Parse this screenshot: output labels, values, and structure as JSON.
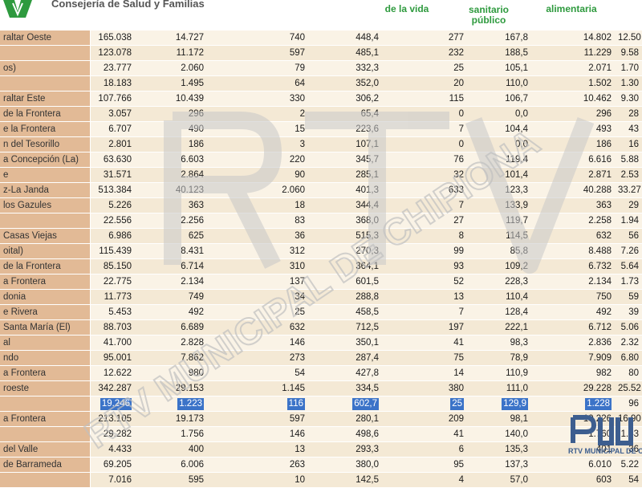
{
  "header": {
    "org_name": "Consejería de Salud y Familias",
    "col_heads": [
      "de la vida",
      "sanitario",
      "público",
      "alimentaria"
    ]
  },
  "watermark": {
    "text": "RTV MUNICIPAL DE CHIPIONA",
    "logo_text": "RTV MUNICIPAL DE CH"
  },
  "colors": {
    "name_cell": "#e2ba96",
    "row_odd": "#faf3e6",
    "row_even": "#f4e9d5",
    "header_text": "#2e9a3e",
    "selection": "#3b73c8"
  },
  "rows": [
    {
      "name": "raltar Oeste",
      "c1": "165.038",
      "c2": "14.727",
      "c3": "740",
      "c4": "448,4",
      "c5": "277",
      "c6": "167,8",
      "c7": "14.802",
      "c8": "12.50"
    },
    {
      "name": "",
      "c1": "123.078",
      "c2": "11.172",
      "c3": "597",
      "c4": "485,1",
      "c5": "232",
      "c6": "188,5",
      "c7": "11.229",
      "c8": "9.58"
    },
    {
      "name": "os)",
      "c1": "23.777",
      "c2": "2.060",
      "c3": "79",
      "c4": "332,3",
      "c5": "25",
      "c6": "105,1",
      "c7": "2.071",
      "c8": "1.70"
    },
    {
      "name": "",
      "c1": "18.183",
      "c2": "1.495",
      "c3": "64",
      "c4": "352,0",
      "c5": "20",
      "c6": "110,0",
      "c7": "1.502",
      "c8": "1.30"
    },
    {
      "name": "raltar Este",
      "c1": "107.766",
      "c2": "10.439",
      "c3": "330",
      "c4": "306,2",
      "c5": "115",
      "c6": "106,7",
      "c7": "10.462",
      "c8": "9.30"
    },
    {
      "name": "de la Frontera",
      "c1": "3.057",
      "c2": "296",
      "c3": "2",
      "c4": "65,4",
      "c5": "0",
      "c6": "0,0",
      "c7": "296",
      "c8": "28"
    },
    {
      "name": "e la Frontera",
      "c1": "6.707",
      "c2": "490",
      "c3": "15",
      "c4": "223,6",
      "c5": "7",
      "c6": "104,4",
      "c7": "493",
      "c8": "43"
    },
    {
      "name": "n del Tesorillo",
      "c1": "2.801",
      "c2": "186",
      "c3": "3",
      "c4": "107,1",
      "c5": "0",
      "c6": "0,0",
      "c7": "186",
      "c8": "16"
    },
    {
      "name": "a Concepción (La)",
      "c1": "63.630",
      "c2": "6.603",
      "c3": "220",
      "c4": "345,7",
      "c5": "76",
      "c6": "119,4",
      "c7": "6.616",
      "c8": "5.88"
    },
    {
      "name": "e",
      "c1": "31.571",
      "c2": "2.864",
      "c3": "90",
      "c4": "285,1",
      "c5": "32",
      "c6": "101,4",
      "c7": "2.871",
      "c8": "2.53"
    },
    {
      "name": "z-La Janda",
      "c1": "513.384",
      "c2": "40.123",
      "c3": "2.060",
      "c4": "401,3",
      "c5": "633",
      "c6": "123,3",
      "c7": "40.288",
      "c8": "33.27"
    },
    {
      "name": "los Gazules",
      "c1": "5.226",
      "c2": "363",
      "c3": "18",
      "c4": "344,4",
      "c5": "7",
      "c6": "133,9",
      "c7": "363",
      "c8": "29"
    },
    {
      "name": "",
      "c1": "22.556",
      "c2": "2.256",
      "c3": "83",
      "c4": "368,0",
      "c5": "27",
      "c6": "119,7",
      "c7": "2.258",
      "c8": "1.94"
    },
    {
      "name": "Casas Viejas",
      "c1": "6.986",
      "c2": "625",
      "c3": "36",
      "c4": "515,3",
      "c5": "8",
      "c6": "114,5",
      "c7": "632",
      "c8": "56"
    },
    {
      "name": "oital)",
      "c1": "115.439",
      "c2": "8.431",
      "c3": "312",
      "c4": "270,3",
      "c5": "99",
      "c6": "85,8",
      "c7": "8.488",
      "c8": "7.26"
    },
    {
      "name": "de la Frontera",
      "c1": "85.150",
      "c2": "6.714",
      "c3": "310",
      "c4": "364,1",
      "c5": "93",
      "c6": "109,2",
      "c7": "6.732",
      "c8": "5.64"
    },
    {
      "name": "a Frontera",
      "c1": "22.775",
      "c2": "2.134",
      "c3": "137",
      "c4": "601,5",
      "c5": "52",
      "c6": "228,3",
      "c7": "2.134",
      "c8": "1.73"
    },
    {
      "name": "donia",
      "c1": "11.773",
      "c2": "749",
      "c3": "34",
      "c4": "288,8",
      "c5": "13",
      "c6": "110,4",
      "c7": "750",
      "c8": "59"
    },
    {
      "name": "e Rivera",
      "c1": "5.453",
      "c2": "492",
      "c3": "25",
      "c4": "458,5",
      "c5": "7",
      "c6": "128,4",
      "c7": "492",
      "c8": "39"
    },
    {
      "name": "Santa María (El)",
      "c1": "88.703",
      "c2": "6.689",
      "c3": "632",
      "c4": "712,5",
      "c5": "197",
      "c6": "222,1",
      "c7": "6.712",
      "c8": "5.06"
    },
    {
      "name": "al",
      "c1": "41.700",
      "c2": "2.828",
      "c3": "146",
      "c4": "350,1",
      "c5": "41",
      "c6": "98,3",
      "c7": "2.836",
      "c8": "2.32"
    },
    {
      "name": "ndo",
      "c1": "95.001",
      "c2": "7.862",
      "c3": "273",
      "c4": "287,4",
      "c5": "75",
      "c6": "78,9",
      "c7": "7.909",
      "c8": "6.80"
    },
    {
      "name": "a Frontera",
      "c1": "12.622",
      "c2": "980",
      "c3": "54",
      "c4": "427,8",
      "c5": "14",
      "c6": "110,9",
      "c7": "982",
      "c8": "80"
    },
    {
      "name": "roeste",
      "c1": "342.287",
      "c2": "29.153",
      "c3": "1.145",
      "c4": "334,5",
      "c5": "380",
      "c6": "111,0",
      "c7": "29.228",
      "c8": "25.52"
    },
    {
      "name": "",
      "c1": "19.246",
      "c2": "1.223",
      "c3": "116",
      "c4": "602,7",
      "c5": "25",
      "c6": "129,9",
      "c7": "1.228",
      "c8": "96",
      "selected": true
    },
    {
      "name": "a Frontera",
      "c1": "213.105",
      "c2": "19.173",
      "c3": "597",
      "c4": "280,1",
      "c5": "209",
      "c6": "98,1",
      "c7": "19.226",
      "c8": "16.90"
    },
    {
      "name": "",
      "c1": "29.282",
      "c2": "1.756",
      "c3": "146",
      "c4": "498,6",
      "c5": "41",
      "c6": "140,0",
      "c7": "1.760",
      "c8": "1.43"
    },
    {
      "name": "del Valle",
      "c1": "4.433",
      "c2": "400",
      "c3": "13",
      "c4": "293,3",
      "c5": "6",
      "c6": "135,3",
      "c7": "401",
      "c8": "36"
    },
    {
      "name": "de Barrameda",
      "c1": "69.205",
      "c2": "6.006",
      "c3": "263",
      "c4": "380,0",
      "c5": "95",
      "c6": "137,3",
      "c7": "6.010",
      "c8": "5.22"
    },
    {
      "name": "",
      "c1": "7.016",
      "c2": "595",
      "c3": "10",
      "c4": "142,5",
      "c5": "4",
      "c6": "57,0",
      "c7": "603",
      "c8": "54"
    }
  ]
}
